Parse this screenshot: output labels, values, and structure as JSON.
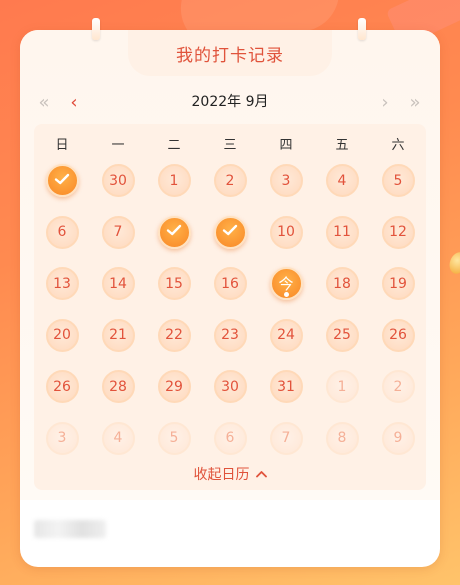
{
  "title": "我的打卡记录",
  "nav": {
    "double_prev": "«",
    "prev": "‹",
    "month": "2022年 9月",
    "next": "›",
    "double_next": "»"
  },
  "weekdays": [
    "日",
    "一",
    "二",
    "三",
    "四",
    "五",
    "六"
  ],
  "weeks": [
    [
      {
        "label": "",
        "state": "checked"
      },
      {
        "label": "30",
        "state": "normal"
      },
      {
        "label": "1",
        "state": "normal"
      },
      {
        "label": "2",
        "state": "normal"
      },
      {
        "label": "3",
        "state": "normal"
      },
      {
        "label": "4",
        "state": "normal"
      },
      {
        "label": "5",
        "state": "normal"
      }
    ],
    [
      {
        "label": "6",
        "state": "normal"
      },
      {
        "label": "7",
        "state": "normal"
      },
      {
        "label": "",
        "state": "checked"
      },
      {
        "label": "",
        "state": "checked"
      },
      {
        "label": "10",
        "state": "normal"
      },
      {
        "label": "11",
        "state": "normal"
      },
      {
        "label": "12",
        "state": "normal"
      }
    ],
    [
      {
        "label": "13",
        "state": "normal"
      },
      {
        "label": "14",
        "state": "normal"
      },
      {
        "label": "15",
        "state": "normal"
      },
      {
        "label": "16",
        "state": "normal"
      },
      {
        "label": "今",
        "state": "today"
      },
      {
        "label": "18",
        "state": "normal"
      },
      {
        "label": "19",
        "state": "normal"
      }
    ],
    [
      {
        "label": "20",
        "state": "normal"
      },
      {
        "label": "21",
        "state": "normal"
      },
      {
        "label": "22",
        "state": "normal"
      },
      {
        "label": "23",
        "state": "normal"
      },
      {
        "label": "24",
        "state": "normal"
      },
      {
        "label": "25",
        "state": "normal"
      },
      {
        "label": "26",
        "state": "normal"
      }
    ],
    [
      {
        "label": "26",
        "state": "normal"
      },
      {
        "label": "28",
        "state": "normal"
      },
      {
        "label": "29",
        "state": "normal"
      },
      {
        "label": "30",
        "state": "normal"
      },
      {
        "label": "31",
        "state": "normal"
      },
      {
        "label": "1",
        "state": "faded"
      },
      {
        "label": "2",
        "state": "faded"
      }
    ],
    [
      {
        "label": "3",
        "state": "faded"
      },
      {
        "label": "4",
        "state": "faded"
      },
      {
        "label": "5",
        "state": "faded"
      },
      {
        "label": "6",
        "state": "faded"
      },
      {
        "label": "7",
        "state": "faded"
      },
      {
        "label": "8",
        "state": "faded"
      },
      {
        "label": "9",
        "state": "faded"
      }
    ]
  ],
  "collapse_label": "收起日历",
  "colors": {
    "accent": "#e0533b",
    "checked": "#f98725",
    "background": "#ff8a50"
  }
}
